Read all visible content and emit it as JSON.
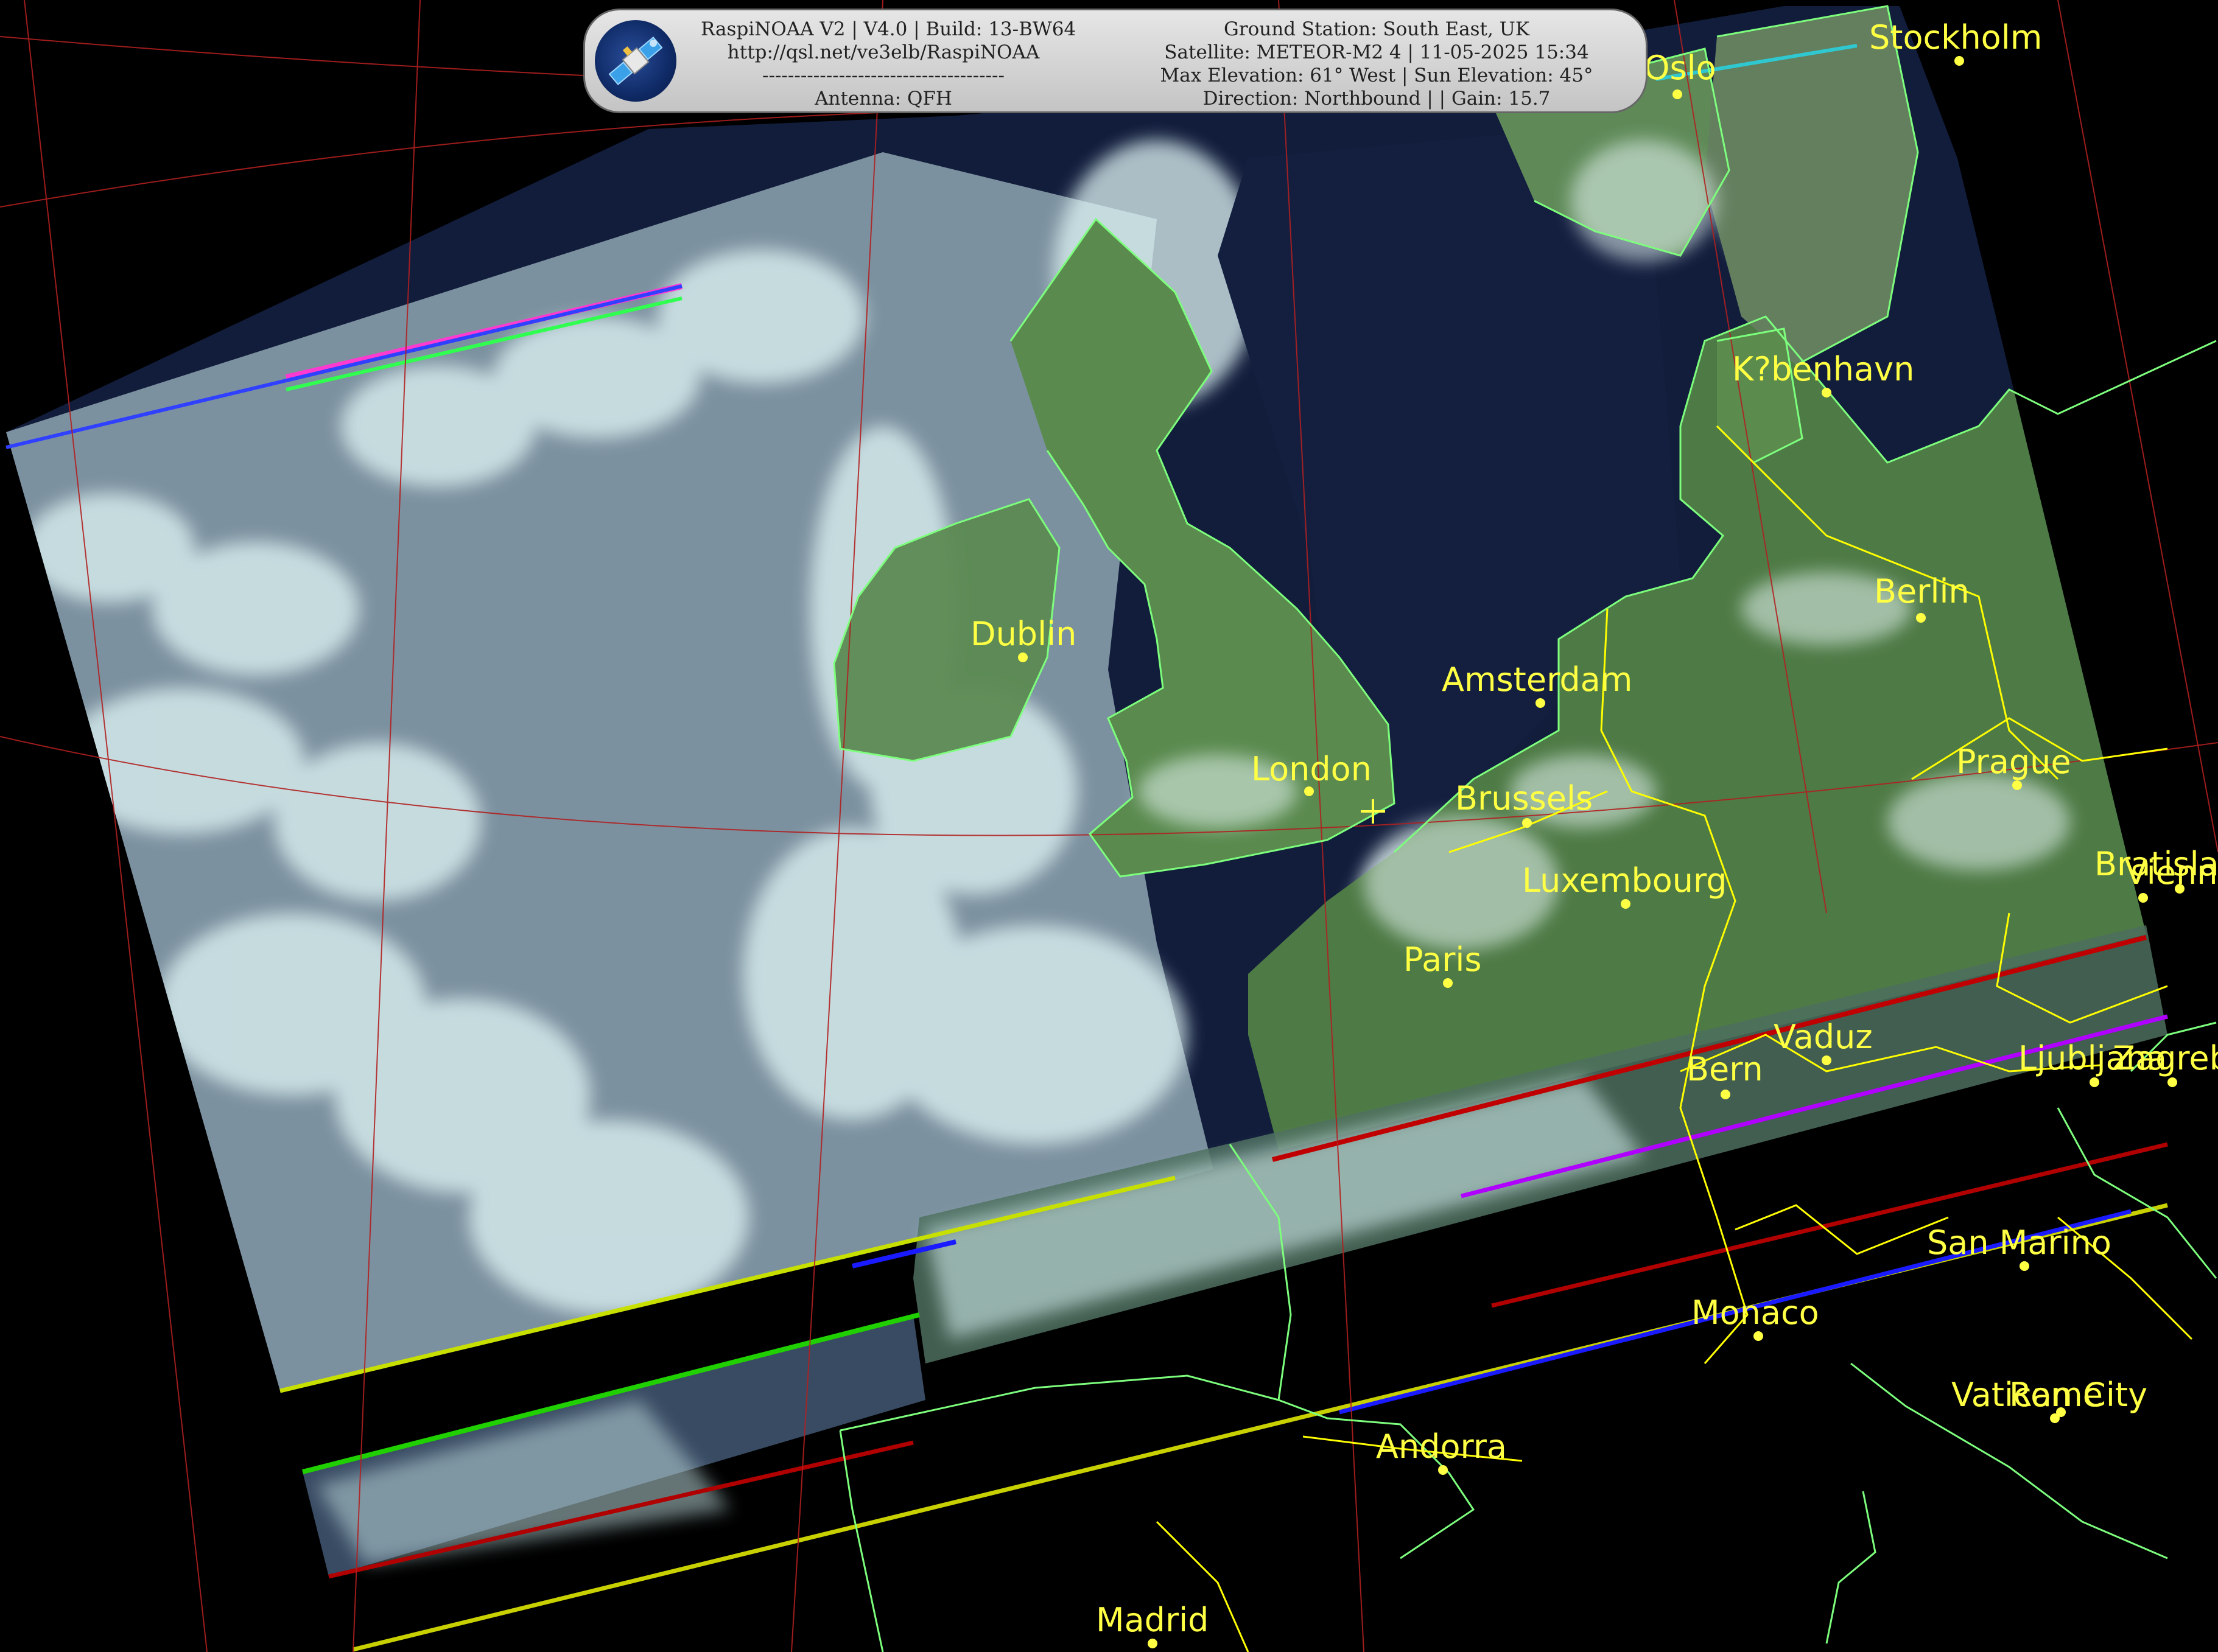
{
  "header": {
    "software_line": "RaspiNOAA V2 | V4.0 | Build: 13-BW64",
    "url_line": "http://qsl.net/ve3elb/RaspiNOAA",
    "separator_line": "--------------------------------------",
    "antenna_line": "Antenna: QFH",
    "ground_station_line": "Ground Station: South East, UK",
    "satellite_line": "Satellite: METEOR-M2 4 | 11-05-2025 15:34",
    "elevation_line": "Max Elevation: 61° West | Sun Elevation: 45°",
    "direction_line": "Direction: Northbound | | Gain: 15.7"
  },
  "cities": [
    {
      "name": "Stockholm"
    },
    {
      "name": "Oslo"
    },
    {
      "name": "K?benhavn"
    },
    {
      "name": "Berlin"
    },
    {
      "name": "Dublin"
    },
    {
      "name": "Amsterdam"
    },
    {
      "name": "London"
    },
    {
      "name": "Brussels"
    },
    {
      "name": "Prague"
    },
    {
      "name": "Luxembourg"
    },
    {
      "name": "Bratislava"
    },
    {
      "name": "Vienna"
    },
    {
      "name": "Paris"
    },
    {
      "name": "Vaduz"
    },
    {
      "name": "Bern"
    },
    {
      "name": "Ljubljana"
    },
    {
      "name": "Zagreb"
    },
    {
      "name": "San Marino"
    },
    {
      "name": "Monaco"
    },
    {
      "name": "Vatican City"
    },
    {
      "name": "Rome"
    },
    {
      "name": "Andorra"
    },
    {
      "name": "Madrid"
    }
  ],
  "colors": {
    "label": "#ffff44",
    "coastline": "#7dff7d",
    "border": "#ffff00",
    "graticule": "#b02020",
    "sea": "#121d3c",
    "land": "#4e7a45",
    "cloud": "#cfeeee"
  }
}
